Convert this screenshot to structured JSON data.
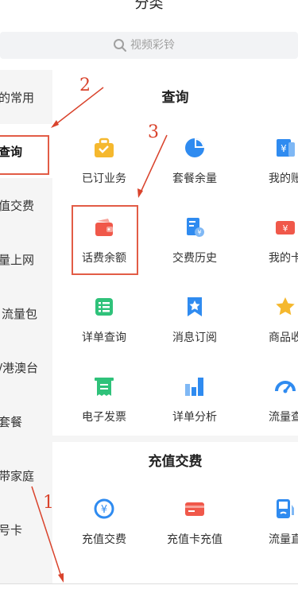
{
  "header": {
    "title": "分类"
  },
  "search": {
    "placeholder": "视频彩铃"
  },
  "sidebar": {
    "items": [
      {
        "label": "的常用"
      },
      {
        "label": "查询"
      },
      {
        "label": "值交费"
      },
      {
        "label": "量上网"
      },
      {
        "label": "流量包"
      },
      {
        "label": "/港澳台"
      },
      {
        "label": "套餐"
      },
      {
        "label": "带家庭"
      },
      {
        "label": "号卡"
      }
    ]
  },
  "main": {
    "section1": {
      "title": "查询",
      "items": [
        {
          "label": "已订业务",
          "icon": "briefcase-icon",
          "color": "#f5b82e"
        },
        {
          "label": "套餐余量",
          "icon": "pie-chart-icon",
          "color": "#2f8bf0"
        },
        {
          "label": "我的账",
          "icon": "yuan-bill-icon",
          "color": "#2f8bf0"
        },
        {
          "label": "话费余额",
          "icon": "wallet-icon",
          "color": "#f0584a"
        },
        {
          "label": "交费历史",
          "icon": "payment-history-icon",
          "color": "#2f8bf0"
        },
        {
          "label": "我的卡",
          "icon": "yuan-card-icon",
          "color": "#f0584a"
        },
        {
          "label": "详单查询",
          "icon": "list-icon",
          "color": "#2fc27a"
        },
        {
          "label": "消息订阅",
          "icon": "bookmark-star-icon",
          "color": "#2f8bf0"
        },
        {
          "label": "商品收",
          "icon": "star-icon",
          "color": "#f5b82e"
        },
        {
          "label": "电子发票",
          "icon": "invoice-icon",
          "color": "#2fc27a"
        },
        {
          "label": "详单分析",
          "icon": "bar-chart-icon",
          "color": "#2f8bf0"
        },
        {
          "label": "流量查",
          "icon": "speedometer-icon",
          "color": "#2f8bf0"
        }
      ]
    },
    "section2": {
      "title": "充值交费",
      "items": [
        {
          "label": "充值交费",
          "icon": "yuan-circle-icon",
          "color": "#2f8bf0"
        },
        {
          "label": "充值卡充值",
          "icon": "recharge-card-icon",
          "color": "#f0584a"
        },
        {
          "label": "流量直",
          "icon": "data-topup-icon",
          "color": "#2f8bf0"
        }
      ]
    }
  },
  "annotations": {
    "step1": "1",
    "step2": "2",
    "step3": "3",
    "color": "#d9432c"
  }
}
